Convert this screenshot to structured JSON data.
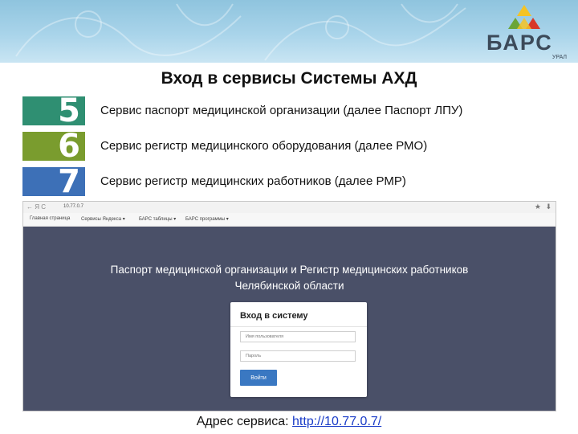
{
  "brand": {
    "name": "БАРС",
    "sub": "УРАЛ",
    "colors": {
      "yellow": "#f5c324",
      "green": "#6aa538",
      "red": "#d8392b",
      "dark": "#3c4a59"
    }
  },
  "slide": {
    "title": "Вход в сервисы Системы АХД",
    "services": [
      {
        "num": "5",
        "text": "Сервис паспорт медицинской организации (далее Паспорт ЛПУ)",
        "color": "#2f8f72"
      },
      {
        "num": "6",
        "text": "Сервис регистр медицинского оборудования (далее РМО)",
        "color": "#7a9c2e"
      },
      {
        "num": "7",
        "text": "Сервис регистр медицинских работников (далее РМР)",
        "color": "#3d70b7"
      }
    ]
  },
  "browser": {
    "nav": "← Я  C",
    "url": "10.77.0.7",
    "bookmarks": [
      "Главная страница",
      "Сервисы Яндекса ▾",
      "БАРС таблицы ▾",
      "БАРС программы ▾"
    ],
    "heading_line1": "Паспорт медицинской организации и Регистр медицинских работников",
    "heading_line2": "Челябинской области",
    "login": {
      "title": "Вход в систему",
      "username_placeholder": "Имя пользователя",
      "password_placeholder": "Пароль",
      "submit_label": "Войти"
    }
  },
  "footer": {
    "label": "Адрес сервиса:",
    "link": "http://10.77.0.7/"
  }
}
